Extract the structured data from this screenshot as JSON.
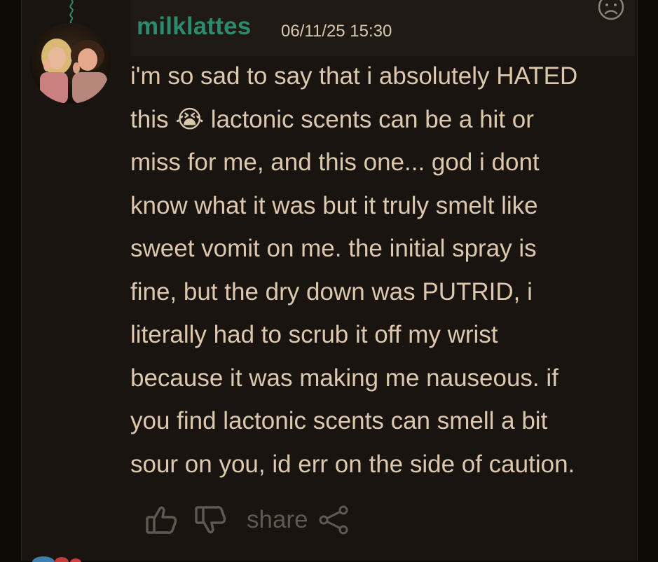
{
  "post": {
    "username": "milklattes",
    "timestamp": "06/11/25 15:30",
    "text_lines": [
      "i'm so sad to say that i absolutely HATED",
      "this 😭 lactonic scents can be a hit or",
      "miss for me, and this one... god i dont",
      "know what it was but it truly smelt like",
      "sweet vomit on me. the initial spray is",
      "fine, but the dry down was PUTRID, i",
      "literally had to scrub it off my wrist",
      "because it was making me nauseous. if",
      "you find lactonic scents can smell a bit",
      "sour on you, id err on the side of caution."
    ]
  },
  "actions": {
    "share_label": "share"
  },
  "icons": {
    "like": "thumbs-up-icon",
    "dislike": "thumbs-down-icon",
    "share": "share-icon",
    "reaction": "sad-face-icon"
  },
  "colors": {
    "background": "#19140f",
    "header": "#1f1a13",
    "username": "#2c8b6e",
    "text": "#dcc8ae",
    "muted": "#5f5850"
  }
}
